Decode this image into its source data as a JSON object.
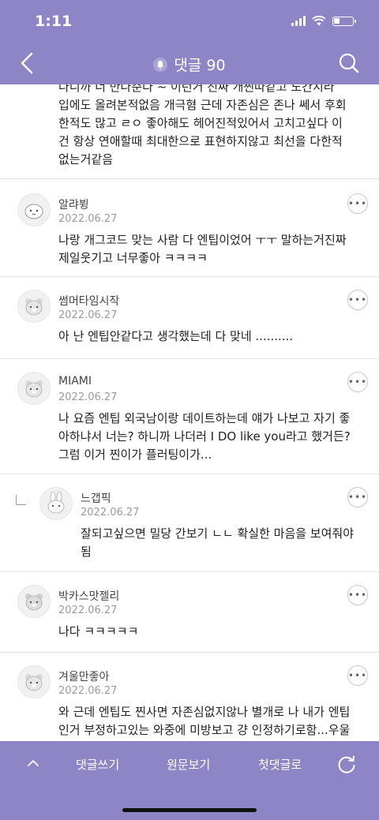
{
  "status": {
    "time": "1:11"
  },
  "header": {
    "title": "댓글 90"
  },
  "first_comment": {
    "text": "나니까 너 만나준다 ~ 이런거 진짜 개찐따같고 노간지라 입에도 올려본적없음 개극혐 근데 자존심은 존나 쎄서 후회한적도 많고 ㄹㅇ 좋아해도 헤어진적있어서 고치고싶다 이건 항상 연애할때 최대한으로 표현하지않고 최선을 다한적 없는거같음"
  },
  "comments": [
    {
      "nick": "알랴뷩",
      "date": "2022.06.27",
      "text": "나랑 개그코드 맞는 사람 다 엔팁이었어 ㅜㅜ 말하는거진짜 제일웃기고 너무좋아 ㅋㅋㅋㅋ",
      "avatar": "blob-avatar-icon"
    },
    {
      "nick": "썸머타임시작",
      "date": "2022.06.27",
      "text": "아 난 엔팁안같다고 생각했는데 다 맞네 ..........",
      "avatar": "bear-avatar-icon"
    },
    {
      "nick": "MIAMI",
      "date": "2022.06.27",
      "text": "나 요즘 엔팁 외국남이랑 데이트하는데 얘가 나보고 자기 좋아하냐서 너는? 하니까 나더러 I DO like you라고 했거든? 그럼 이거 찐이가 플러팅이가...",
      "avatar": "bear-avatar-icon"
    },
    {
      "nick": "느갭픽",
      "date": "2022.06.27",
      "text": "잘되고싶으면 밀당 간보기 ㄴㄴ 확실한 마음을 보여줘야 됨",
      "avatar": "bunny-avatar-icon",
      "reply": true
    },
    {
      "nick": "박카스맛젤리",
      "date": "2022.06.27",
      "text": "나다 ㅋㅋㅋㅋㅋ",
      "avatar": "bear-avatar-icon"
    },
    {
      "nick": "겨울만좋아",
      "date": "2022.06.27",
      "text": "와 근데 엔팁도 찐사면 자존심없지않나 별개로 나 내가 엔팁인거 부정하고있는 와중에 미방보고 걍 인정하기로함...우울한 와중에 사실 나 인팁인가 했는데 통수맞은느낌ㅋㅋㅋㅋㅋ",
      "avatar": "bear-avatar-icon"
    }
  ],
  "more_label": "•••",
  "bottom": {
    "write": "댓글쓰기",
    "original": "원문보기",
    "first": "첫댓글로"
  },
  "colors": {
    "accent": "#8d85c6"
  }
}
